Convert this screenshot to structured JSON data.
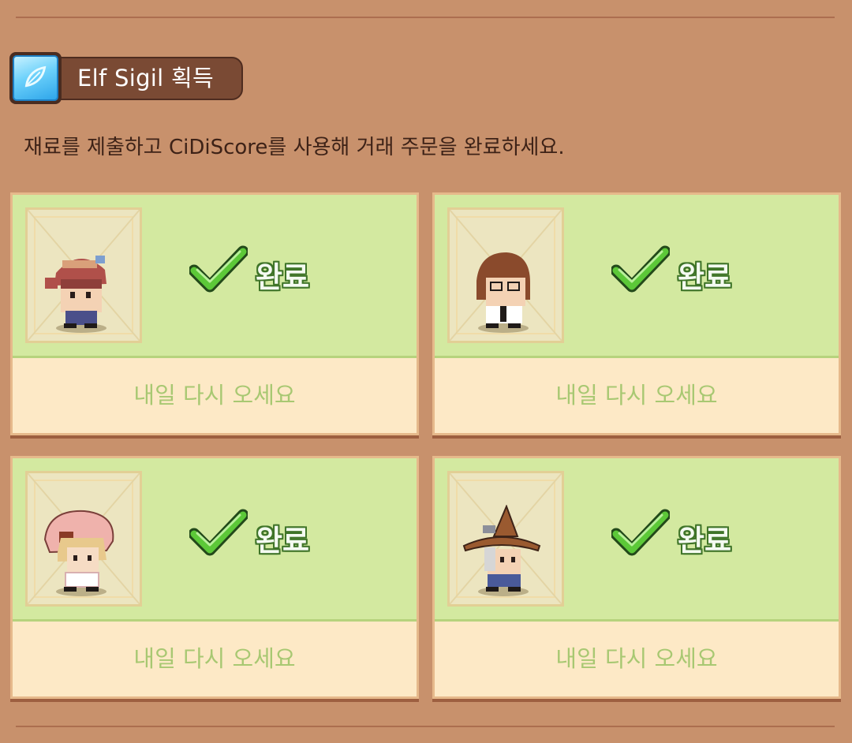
{
  "header": {
    "title": "Elf Sigil 획득",
    "icon": "elf-sigil-icon",
    "description": "재료를 제출하고 CiDiScore를 사용해 거래 주문을 완료하세요."
  },
  "orders": [
    {
      "character": "pink-hair-goggles-character",
      "status": "완료",
      "footer": "내일 다시 오세요"
    },
    {
      "character": "brown-hair-glasses-character",
      "status": "완료",
      "footer": "내일 다시 오세요"
    },
    {
      "character": "pink-hood-blonde-character",
      "status": "완료",
      "footer": "내일 다시 오세요"
    },
    {
      "character": "witch-hat-character",
      "status": "완료",
      "footer": "내일 다시 오세요"
    }
  ],
  "colors": {
    "background": "#c8916c",
    "card_top": "#d3e9a0",
    "card_bottom": "#fde9c6",
    "check_green": "#5cc838",
    "footer_text": "#a8c872"
  }
}
